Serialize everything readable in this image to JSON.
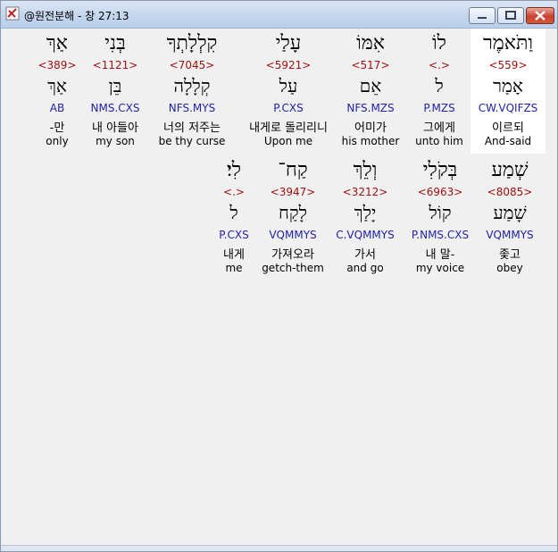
{
  "window": {
    "title": "@원전분해 - 창 27:13",
    "icon": "app-icon",
    "controls": [
      "minimize-icon",
      "maximize-icon",
      "close-icon"
    ]
  },
  "rows": [
    [
      {
        "heb": "וַתֹּאמֶר",
        "strong": "<559>",
        "lemma": "אָמַר",
        "morph": "CW.VQIFZS",
        "kor": "이르되",
        "eng": "And-said",
        "selected": true
      },
      {
        "heb": "לוֹ",
        "strong": "<.>",
        "lemma": "ל",
        "morph": "P.MZS",
        "kor": "그에게",
        "eng": "unto him"
      },
      {
        "heb": "אִמּוֹ",
        "strong": "<517>",
        "lemma": "אֵם",
        "morph": "NFS.MZS",
        "kor": "어미가",
        "eng": "his mother"
      },
      {
        "heb": "עָלַי",
        "strong": "<5921>",
        "lemma": "עַל",
        "morph": "P.CXS",
        "kor": "내게로 돌리리니",
        "eng": "Upon me"
      },
      {
        "heb": "קִלְלָתְךָ",
        "strong": "<7045>",
        "lemma": "קְלָלָה",
        "morph": "NFS.MYS",
        "kor": "너의 저주는",
        "eng": "be thy curse"
      },
      {
        "heb": "בְּנִי",
        "strong": "<1121>",
        "lemma": "בֵּן",
        "morph": "NMS.CXS",
        "kor": "내 아들아",
        "eng": "my son"
      },
      {
        "heb": "אַךְ",
        "strong": "<389>",
        "lemma": "אַךְ",
        "morph": "AB",
        "kor": "-만",
        "eng": "only"
      }
    ],
    [
      {
        "heb": "שְׁמַע",
        "strong": "<8085>",
        "lemma": "שָׁמַע",
        "morph": "VQMMYS",
        "kor": "좇고",
        "eng": "obey"
      },
      {
        "heb": "בְּקֹלִי",
        "strong": "<6963>",
        "lemma": "קוֹל",
        "morph": "P.NMS.CXS",
        "kor": "내 말-",
        "eng": "my voice"
      },
      {
        "heb": "וְלֵךְ",
        "strong": "<3212>",
        "lemma": "יָלַךְ",
        "morph": "C.VQMMYS",
        "kor": "가서",
        "eng": "and go"
      },
      {
        "heb": "קַח־",
        "strong": "<3947>",
        "lemma": "לָקַח",
        "morph": "VQMMYS",
        "kor": "가져오라",
        "eng": "getch-them"
      },
      {
        "heb": "לִי׃",
        "strong": "<.>",
        "lemma": "ל",
        "morph": "P.CXS",
        "kor": "내게",
        "eng": "me"
      }
    ]
  ]
}
